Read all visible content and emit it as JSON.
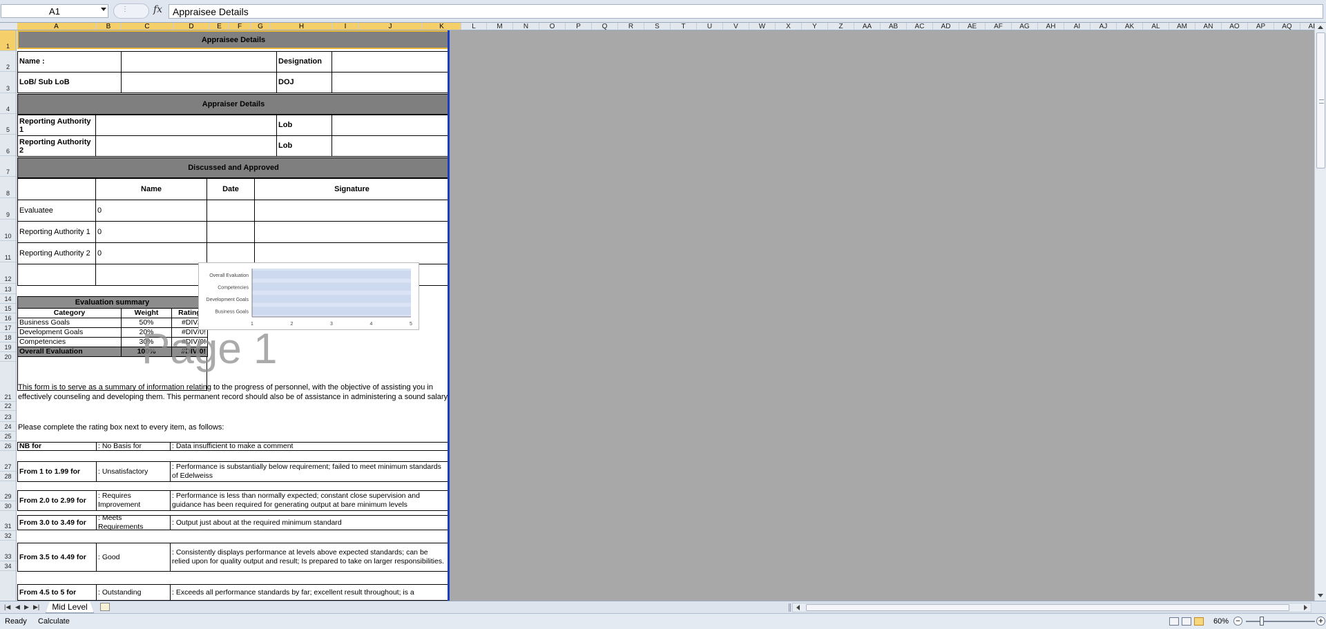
{
  "name_box": "A1",
  "formula_bar": {
    "fx_label": "fx",
    "value": "Appraisee Details"
  },
  "columns": [
    "A",
    "B",
    "C",
    "D",
    "E",
    "F",
    "G",
    "H",
    "I",
    "J",
    "K",
    "L",
    "M",
    "N",
    "O",
    "P",
    "Q",
    "R",
    "S",
    "T",
    "U",
    "V",
    "W",
    "X",
    "Y",
    "Z",
    "AA",
    "AB",
    "AC",
    "AD",
    "AE",
    "AF",
    "AG",
    "AH",
    "AI",
    "AJ",
    "AK",
    "AL",
    "AM",
    "AN",
    "AO",
    "AP",
    "AQ",
    "AR"
  ],
  "rows": [
    "1",
    "2",
    "3",
    "4",
    "5",
    "6",
    "7",
    "8",
    "9",
    "10",
    "11",
    "12",
    "13",
    "14",
    "15",
    "16",
    "17",
    "18",
    "19",
    "20",
    "21",
    "22",
    "23",
    "24",
    "25",
    "26",
    "27",
    "28",
    "29",
    "30",
    "31",
    "32",
    "33",
    "34"
  ],
  "sheet": {
    "appraisee_header": "Appraisee Details",
    "name_label": "Name :",
    "designation_label": "Designation",
    "lob_label": "LoB/ Sub LoB",
    "doj_label": "DOJ",
    "appraiser_header": "Appraiser Details",
    "ra1_label": "Reporting Authority 1",
    "ra2_label": "Reporting Authority 2",
    "lob_short": "Lob",
    "discussed_header": "Discussed and Approved",
    "col_name": "Name",
    "col_date": "Date",
    "col_signature": "Signature",
    "evaluatee": "Evaluatee",
    "ra1": "Reporting Authority 1",
    "ra2": "Reporting Authority 2",
    "zero": "0",
    "eval_summary": {
      "title": "Evaluation summary",
      "headers": [
        "Category",
        "Weight",
        "Rating"
      ],
      "rows": [
        {
          "category": "Business Goals",
          "weight": "50%",
          "rating": "#DIV/0!"
        },
        {
          "category": "Development Goals",
          "weight": "20%",
          "rating": "#DIV/0!"
        },
        {
          "category": "Competencies",
          "weight": "30%",
          "rating": "#DIV/0!"
        }
      ],
      "total": {
        "category": "Overall Evaluation",
        "weight": "100%",
        "rating": "#DIV/0!"
      }
    },
    "watermark": "Page 1",
    "intro_text": "This form is to serve as a summary of information relating to the progress of personnel, with the objective of assisting you in effectively counseling and developing them.  This permanent record should also be of assistance in administering a sound salary",
    "instruction": "Please complete the rating box next to every item, as follows:",
    "ratings": [
      {
        "range": "NB for",
        "label": ": No Basis for",
        "desc": ":  Data insufficient to make a comment"
      },
      {
        "range": "From 1 to 1.99 for",
        "label": ": Unsatisfactory",
        "desc": " : Performance is substantially below requirement;  failed to meet minimum standards of Edelweiss"
      },
      {
        "range": "From 2.0 to 2.99  for",
        "label": " : Requires Improvement",
        "desc": ": Performance is less than normally expected; constant close supervision and guidance has been required for generating output at bare minimum levels"
      },
      {
        "range": "From 3.0  to 3.49 for",
        "label": ": Meets Requirements",
        "desc": " : Output just about at the required minimum standard"
      },
      {
        "range": "From 3.5 to 4.49  for",
        "label": ": Good",
        "desc": ": Consistently displays performance at levels above expected standards; can be relied upon for quality output and result; Is prepared to take on larger responsibilities."
      },
      {
        "range": "From 4.5 to 5  for",
        "label": ": Outstanding",
        "desc": ": Exceeds all performance standards by far; excellent result throughout;  is a"
      }
    ]
  },
  "chart_data": {
    "type": "bar",
    "orientation": "horizontal",
    "categories": [
      "Business Goals",
      "Development Goals",
      "Competencies",
      "Overall Evaluation"
    ],
    "values": [
      0,
      0,
      0,
      0
    ],
    "xlim": [
      1,
      5
    ],
    "xticks": [
      "1",
      "2",
      "3",
      "4",
      "5"
    ]
  },
  "tabs": {
    "sheet_name": "Mid Level"
  },
  "status": {
    "ready": "Ready",
    "calculate": "Calculate",
    "zoom": "60%"
  }
}
